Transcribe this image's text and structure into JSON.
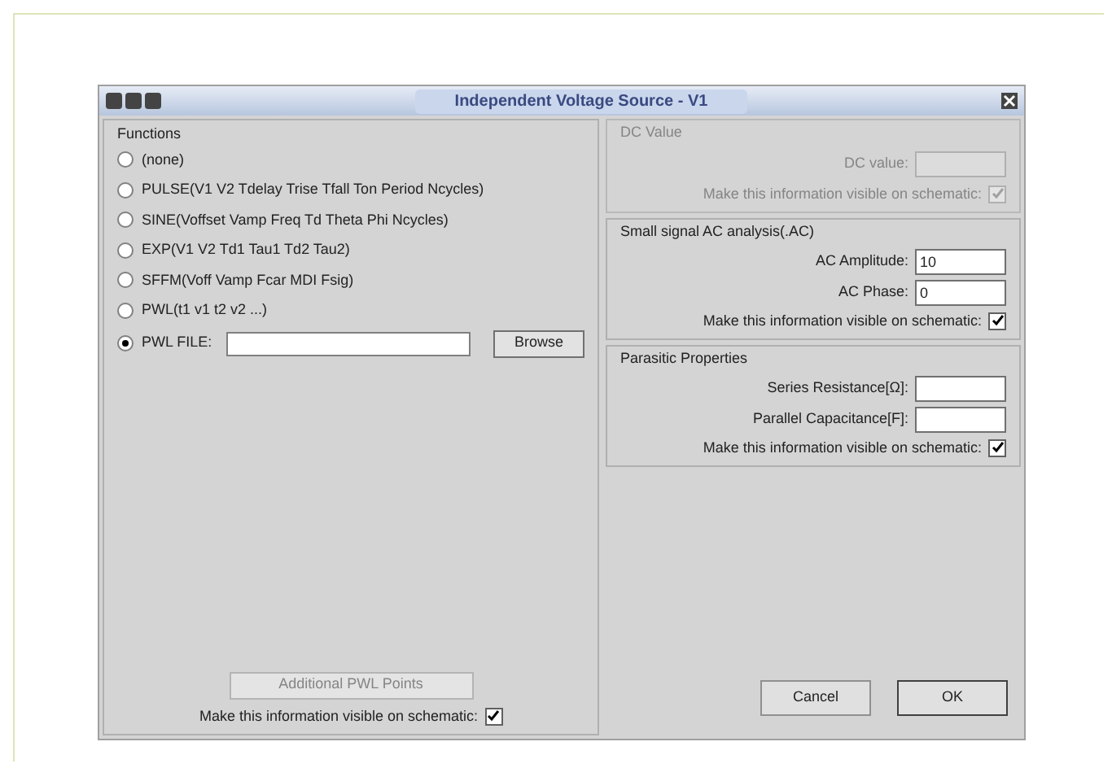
{
  "window": {
    "title": "Independent Voltage Source - V1"
  },
  "functions": {
    "title": "Functions",
    "options": [
      {
        "label": "(none)",
        "selected": false
      },
      {
        "label": "PULSE(V1 V2 Tdelay Trise Tfall Ton Period Ncycles)",
        "selected": false
      },
      {
        "label": "SINE(Voffset Vamp Freq Td Theta Phi Ncycles)",
        "selected": false
      },
      {
        "label": "EXP(V1 V2 Td1 Tau1 Td2 Tau2)",
        "selected": false
      },
      {
        "label": "SFFM(Voff Vamp Fcar MDI Fsig)",
        "selected": false
      },
      {
        "label": "PWL(t1 v1 t2 v2 ...)",
        "selected": false
      },
      {
        "label": "PWL FILE:",
        "selected": true
      }
    ],
    "browse_button": "Browse",
    "additional_button": {
      "label": "Additional PWL Points",
      "disabled": true
    },
    "visible": {
      "label": "Make this information visible on schematic:",
      "checked": true
    }
  },
  "dc": {
    "title": "DC Value",
    "disabled": true,
    "field_label": "DC value:",
    "visible": {
      "label": "Make this information visible on schematic:",
      "checked": true
    }
  },
  "ac": {
    "title": "Small signal AC analysis(.AC)",
    "fields": [
      {
        "label": "AC Amplitude:",
        "value": "10"
      },
      {
        "label": "AC Phase:",
        "value": "0"
      }
    ],
    "visible": {
      "label": "Make this information visible on schematic:",
      "checked": true
    }
  },
  "parasitic": {
    "title": "Parasitic Properties",
    "fields": [
      {
        "label": "Series Resistance[Ω]:"
      },
      {
        "label": "Parallel Capacitance[F]:"
      }
    ],
    "visible": {
      "label": "Make this information visible on schematic:",
      "checked": true
    }
  },
  "buttons": [
    "Cancel",
    "OK"
  ]
}
